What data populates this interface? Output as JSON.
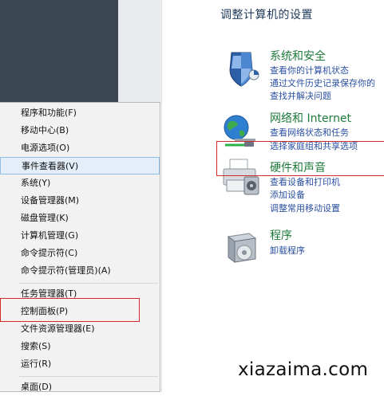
{
  "control_panel": {
    "title": "调整计算机的设置",
    "categories": [
      {
        "title": "系统和安全",
        "icon": "shield-icon",
        "links": [
          "查看你的计算机状态",
          "通过文件历史记录保存你的",
          "查找并解决问题"
        ]
      },
      {
        "title": "网络和 Internet",
        "icon": "network-globe-icon",
        "links": [
          "查看网络状态和任务",
          "选择家庭组和共享选项"
        ]
      },
      {
        "title": "硬件和声音",
        "icon": "printer-icon",
        "links": [
          "查看设备和打印机",
          "添加设备",
          "调整常用移动设置"
        ]
      },
      {
        "title": "程序",
        "icon": "programs-box-icon",
        "links": [
          "卸载程序"
        ]
      }
    ]
  },
  "context_menu": {
    "items": [
      "程序和功能(F)",
      "移动中心(B)",
      "电源选项(O)",
      "事件查看器(V)",
      "系统(Y)",
      "设备管理器(M)",
      "磁盘管理(K)",
      "计算机管理(G)",
      "命令提示符(C)",
      "命令提示符(管理员)(A)",
      "任务管理器(T)",
      "控制面板(P)",
      "文件资源管理器(E)",
      "搜索(S)",
      "运行(R)",
      "桌面(D)"
    ],
    "hovered_item": "事件查看器(V)"
  },
  "watermark": "xiazaima.com",
  "colors": {
    "highlight_border": "#d12a2a",
    "category_title": "#1e7a3b",
    "link": "#2a4fa0",
    "desktop": "#3a4753"
  }
}
